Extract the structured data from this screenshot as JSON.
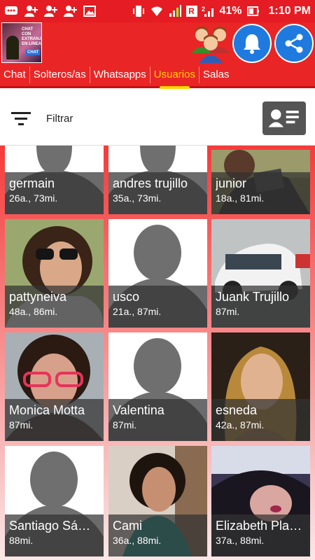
{
  "status_bar": {
    "battery": "41%",
    "time": "1:10 PM",
    "network_badge": "R",
    "signal_badge": "2"
  },
  "app_bar": {
    "logo": {
      "line1": "CHAT CON EXTRANJEROS EN LINEA",
      "line2": "CHAT"
    }
  },
  "tabs": [
    {
      "label": "Chat",
      "active": false
    },
    {
      "label": "Solteros/as",
      "active": false
    },
    {
      "label": "Whatsapps",
      "active": false
    },
    {
      "label": "Usuarios",
      "active": true
    },
    {
      "label": "Salas",
      "active": false
    }
  ],
  "filter": {
    "label": "Filtrar"
  },
  "users": [
    {
      "name": "germain",
      "meta": "26a., 73mi.",
      "photo": "placeholder"
    },
    {
      "name": "andres trujillo",
      "meta": "35a., 73mi.",
      "photo": "placeholder"
    },
    {
      "name": "junior",
      "meta": "18a., 81mi.",
      "photo": "photo"
    },
    {
      "name": "pattyneiva",
      "meta": "48a., 86mi.",
      "photo": "photo"
    },
    {
      "name": "usco",
      "meta": "21a., 87mi.",
      "photo": "placeholder"
    },
    {
      "name": "Juank Trujillo",
      "meta": "87mi.",
      "photo": "photo"
    },
    {
      "name": "Monica Motta",
      "meta": "87mi.",
      "photo": "photo"
    },
    {
      "name": "Valentina",
      "meta": "87mi.",
      "photo": "placeholder"
    },
    {
      "name": "esneda",
      "meta": "42a., 87mi.",
      "photo": "photo"
    },
    {
      "name": "Santiago Sá…",
      "meta": "88mi.",
      "photo": "placeholder"
    },
    {
      "name": "Cami",
      "meta": "36a., 88mi.",
      "photo": "photo"
    },
    {
      "name": "Elizabeth Pla…",
      "meta": "37a., 88mi.",
      "photo": "photo"
    }
  ],
  "colors": {
    "primary": "#ea2525",
    "accent": "#ffd400",
    "fab": "#1f7ae0"
  }
}
